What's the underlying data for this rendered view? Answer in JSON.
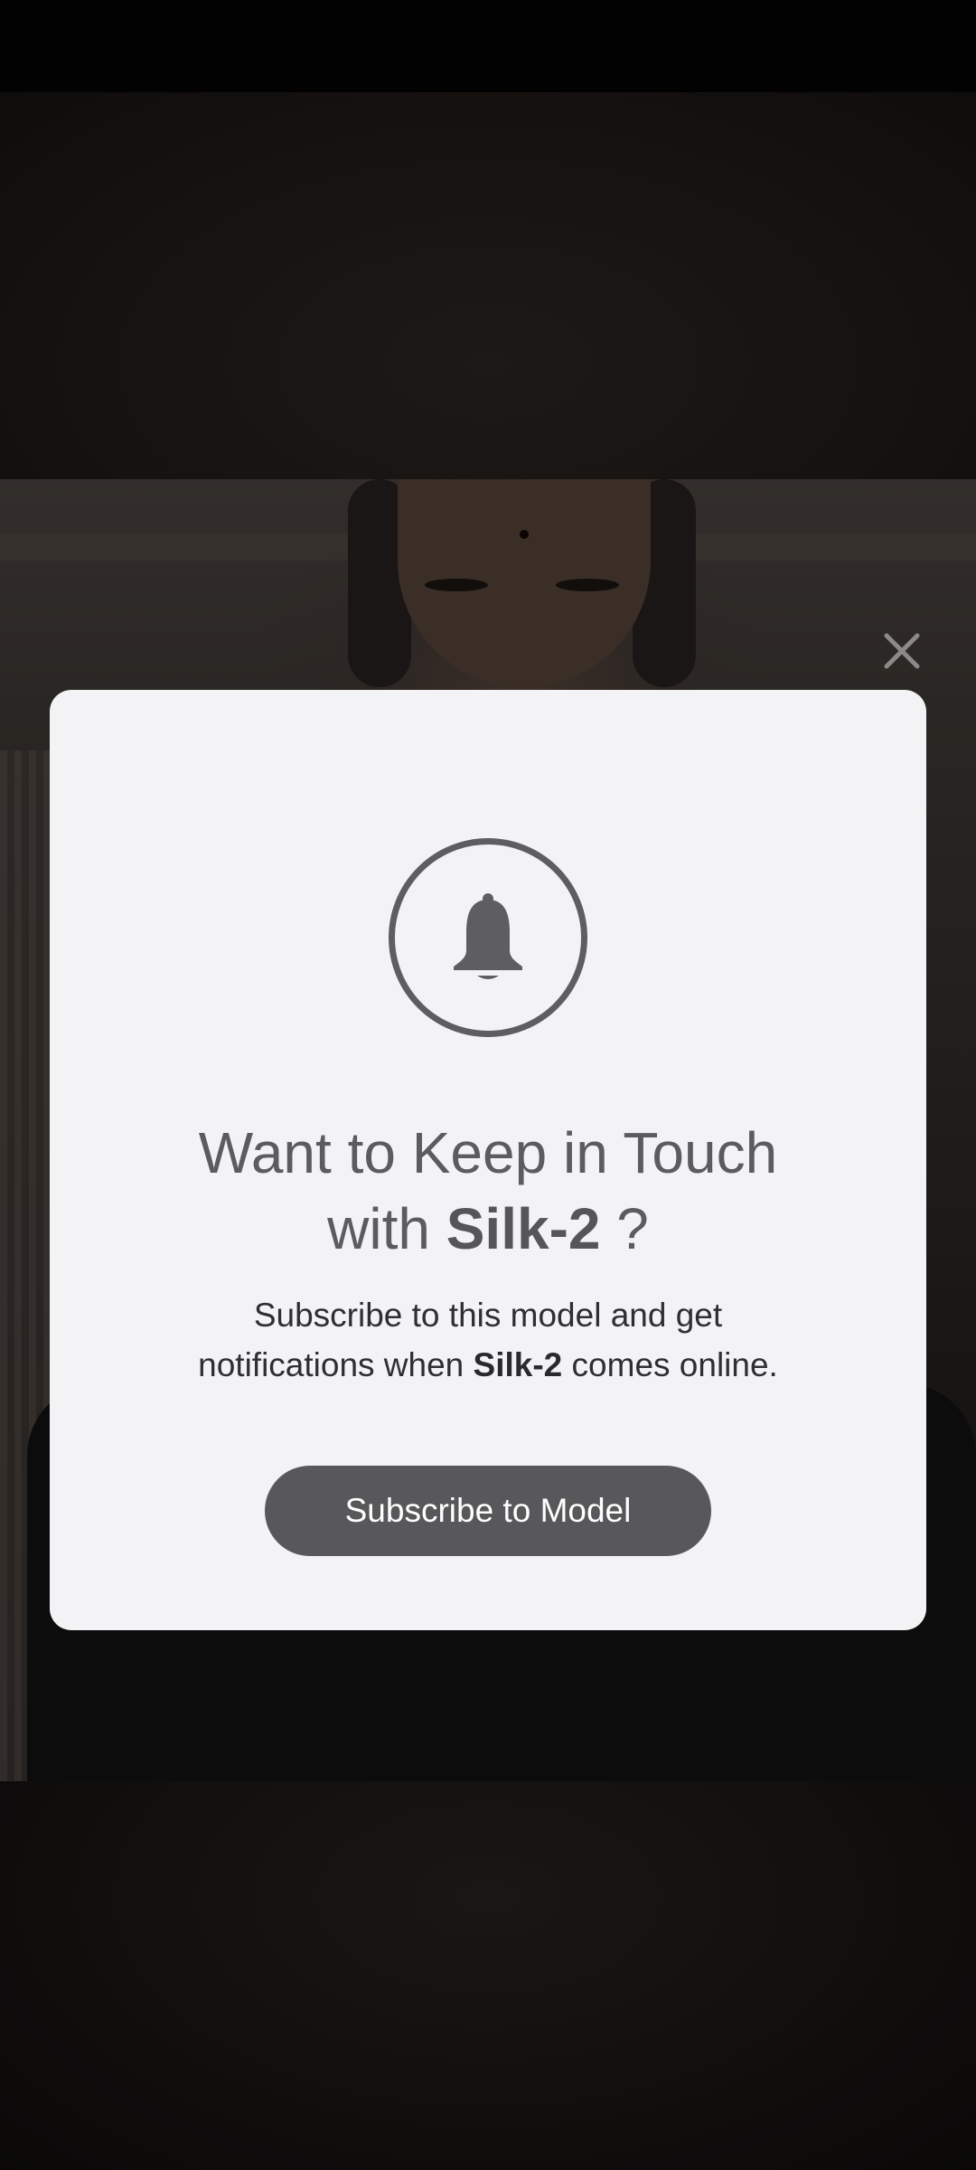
{
  "modal": {
    "title_line1": "Want to Keep in Touch",
    "title_with": "with",
    "model_name": "Silk-2",
    "title_suffix": " ?",
    "desc_line1": "Subscribe to this model and get",
    "desc_prefix": "notifications when",
    "desc_suffix": "comes online.",
    "subscribe_label": "Subscribe to Model"
  },
  "icons": {
    "close": "close-icon",
    "bell": "bell-icon"
  },
  "colors": {
    "modal_background": "#f3f3f5",
    "button_background": "#58585b",
    "icon_gray": "#5e5e61",
    "close_icon": "#8a8a8a"
  }
}
